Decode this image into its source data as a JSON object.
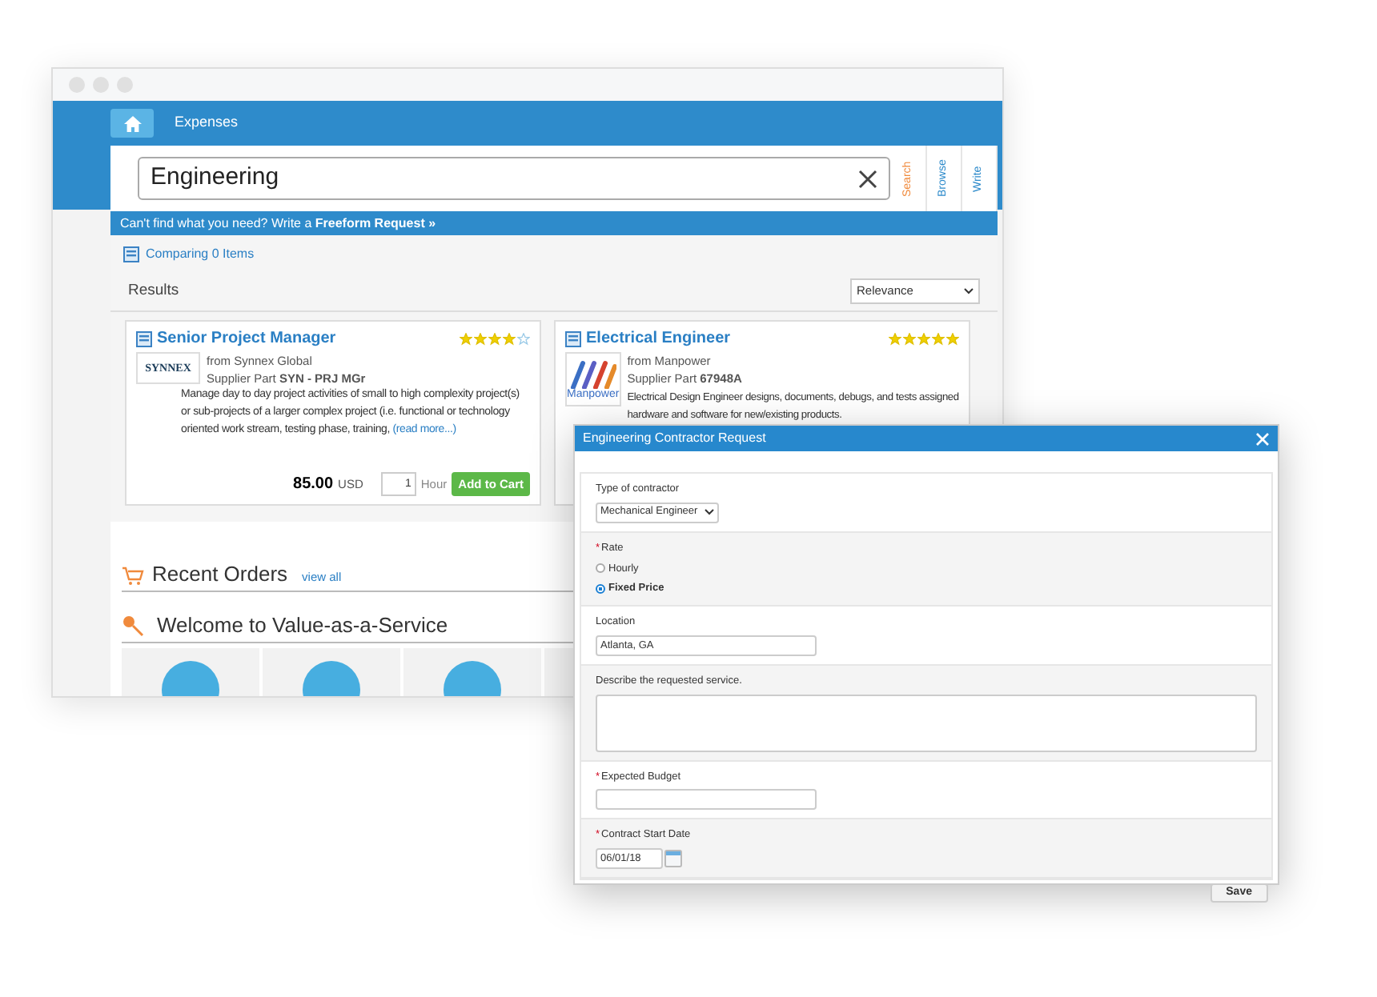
{
  "nav": {
    "tab": "Expenses"
  },
  "search": {
    "value": "Engineering"
  },
  "side_tabs": [
    {
      "label": "Search",
      "selected": true
    },
    {
      "label": "Browse",
      "selected": false
    },
    {
      "label": "Write",
      "selected": false
    }
  ],
  "freeform_bar": "Can't find what you need? Write a **Freeform Request »**",
  "compare": "Comparing 0 Items",
  "results": {
    "title": "Results",
    "sort": "Relevance"
  },
  "cards": [
    {
      "title": "Senior Project Manager",
      "stars": 4,
      "kind": "synnex",
      "logo_text": "SYNNEX",
      "supplier": "from Synnex Global",
      "part": "Supplier Part **SYN - PRJ MGr**",
      "description": "Manage day to day project activities of small to high complexity project(s) or sub-projects of a larger complex project (i.e. functional or technology oriented work stream, testing phase, training,",
      "read_more": "(read more...)",
      "price": "85.00",
      "currency": "USD",
      "quantity": "1",
      "unit": "Hour",
      "button": "Add to Cart"
    },
    {
      "title": "Electrical Engineer",
      "stars": 5,
      "kind": "manpower",
      "logo_text": "Manpower",
      "supplier": "from Manpower",
      "part": "Supplier Part **67948A**",
      "description": "Electrical Design Engineer designs, documents, debugs, and tests assigned hardware and software for new/existing products."
    }
  ],
  "recent_orders": {
    "title": "Recent Orders",
    "link": "view all"
  },
  "welcome": {
    "title": "Welcome to Value-as-a-Service"
  },
  "dialog": {
    "title": "Engineering Contractor Request",
    "fields": [
      {
        "kind": "select",
        "label": "Type of contractor",
        "value": "Mechanical Engineer"
      },
      {
        "kind": "radio",
        "required_mark": "*",
        "label": "Rate",
        "options": [
          {
            "label": "Hourly",
            "selected": false
          },
          {
            "label": "Fixed Price",
            "selected": true
          }
        ]
      },
      {
        "kind": "text",
        "label": "Location",
        "value": "Atlanta, GA"
      },
      {
        "kind": "textarea",
        "label": "Describe the requested service."
      },
      {
        "kind": "text",
        "required_mark": "*",
        "label": "Expected Budget"
      },
      {
        "kind": "date",
        "required_mark": "*",
        "label": "Contract Start Date",
        "value": "06/01/18"
      }
    ],
    "button": "Save"
  }
}
